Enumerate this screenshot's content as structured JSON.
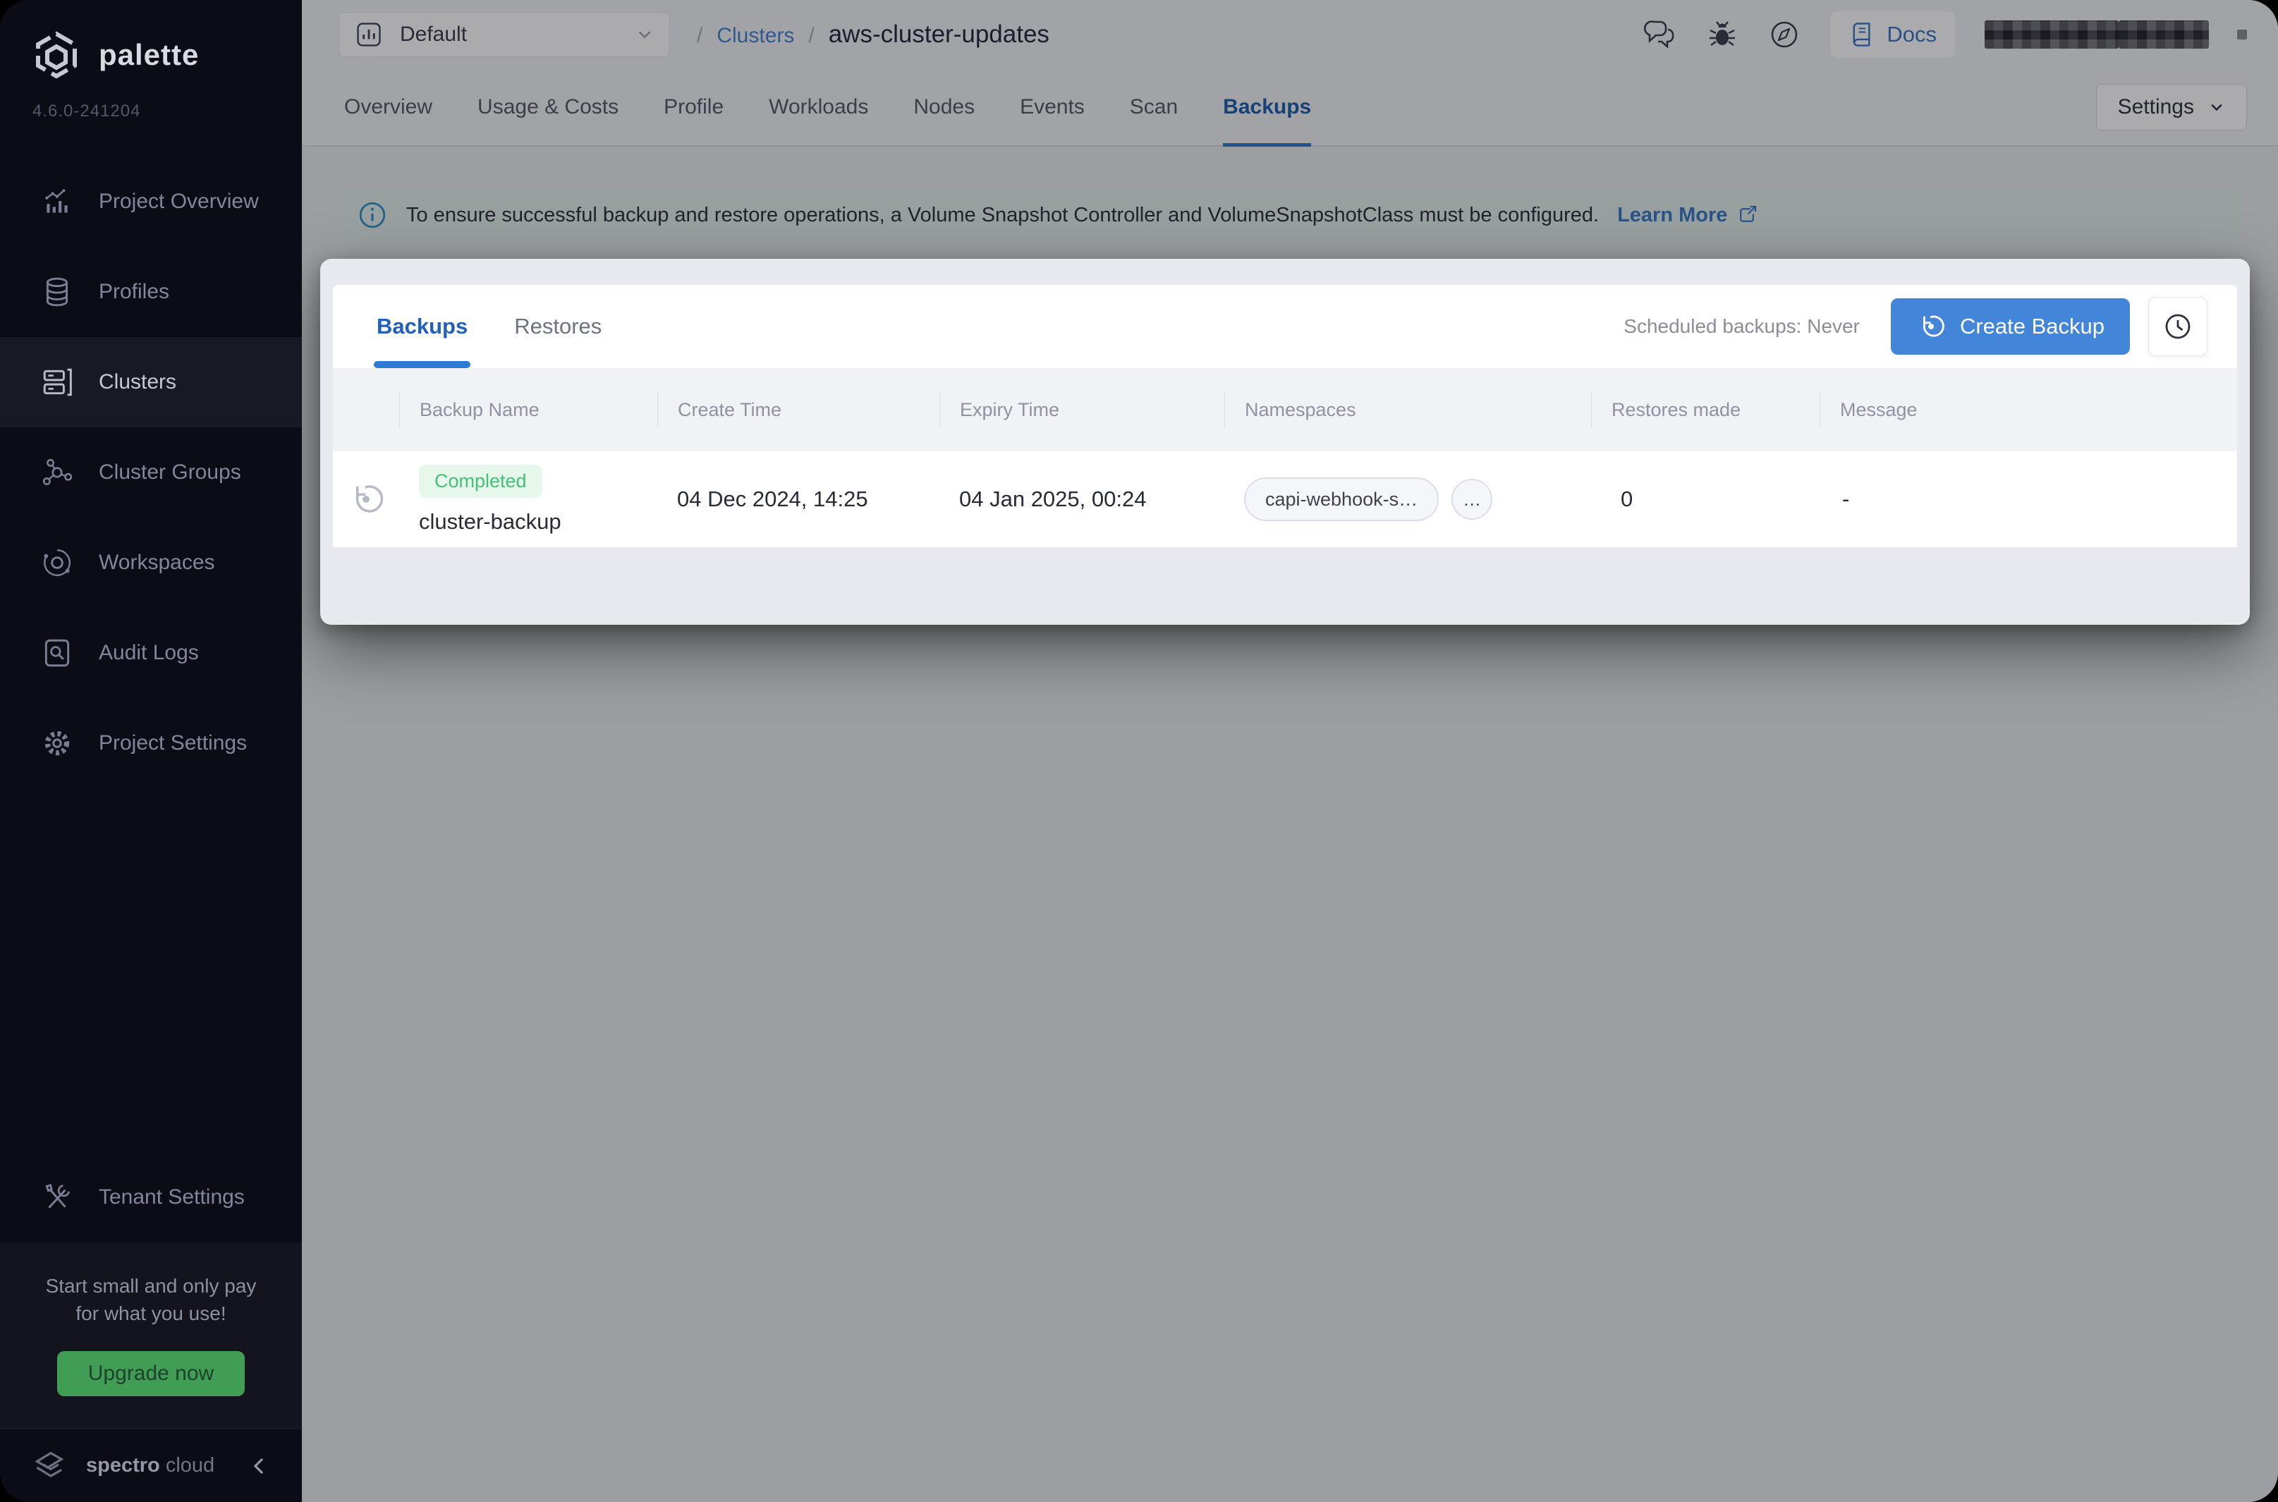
{
  "sidebar": {
    "brand": "palette",
    "version": "4.6.0-241204",
    "items": [
      {
        "label": "Project Overview",
        "icon": "bar-chart-icon"
      },
      {
        "label": "Profiles",
        "icon": "layers-icon"
      },
      {
        "label": "Clusters",
        "icon": "server-icon",
        "active": true
      },
      {
        "label": "Cluster Groups",
        "icon": "network-icon"
      },
      {
        "label": "Workspaces",
        "icon": "orbit-icon"
      },
      {
        "label": "Audit Logs",
        "icon": "audit-icon"
      },
      {
        "label": "Project Settings",
        "icon": "gear-icon"
      }
    ],
    "tenant_settings_label": "Tenant Settings",
    "promo": {
      "line1": "Start small and only pay",
      "line2": "for what you use!",
      "button_label": "Upgrade now"
    },
    "footer_brand_bold": "spectro",
    "footer_brand_light": "cloud"
  },
  "topbar": {
    "project_select_value": "Default",
    "breadcrumb": {
      "sep1": "/",
      "link": "Clusters",
      "sep2": "/",
      "current": "aws-cluster-updates"
    },
    "docs_label": "Docs"
  },
  "cluster_tabs": {
    "items": [
      "Overview",
      "Usage & Costs",
      "Profile",
      "Workloads",
      "Nodes",
      "Events",
      "Scan",
      "Backups"
    ],
    "active": "Backups"
  },
  "settings_button_label": "Settings",
  "banner": {
    "text": "To ensure successful backup and restore operations, a Volume Snapshot Controller and VolumeSnapshotClass must be configured.",
    "link_label": "Learn More"
  },
  "backups_panel": {
    "tabs": [
      "Backups",
      "Restores"
    ],
    "active_tab": "Backups",
    "scheduled_label": "Scheduled backups: Never",
    "create_button_label": "Create Backup",
    "table": {
      "headers": [
        "Backup Name",
        "Create Time",
        "Expiry Time",
        "Namespaces",
        "Restores made",
        "Message"
      ],
      "rows": [
        {
          "status": "Completed",
          "name": "cluster-backup",
          "create_time": "04 Dec 2024, 14:25",
          "expiry_time": "04 Jan 2025, 00:24",
          "namespace_chip": "capi-webhook-s…",
          "namespaces_more": "…",
          "restores_made": "0",
          "message": "-"
        }
      ]
    }
  },
  "colors": {
    "accent_blue": "#4385d9",
    "link_blue": "#3a77c8",
    "badge_green": "#45bf77",
    "upgrade_green": "#3f9e53",
    "sidebar_bg": "#0c0c17"
  }
}
